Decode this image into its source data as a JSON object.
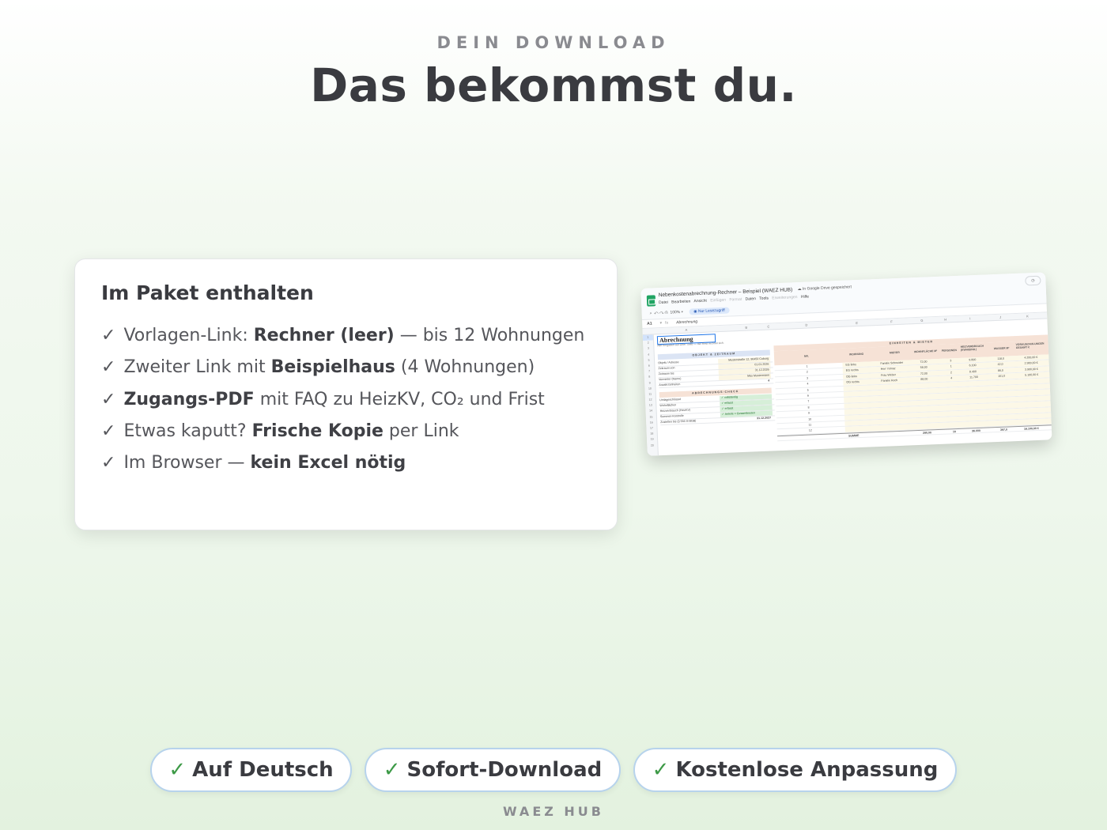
{
  "header": {
    "eyebrow": "DEIN DOWNLOAD",
    "title": "Das bekommst du."
  },
  "card": {
    "title": "Im Paket enthalten",
    "check_glyph": "✓",
    "items": [
      {
        "pre": "Vorlagen-Link: ",
        "bold": "Rechner (leer)",
        "post": " — bis 12 Wohnungen"
      },
      {
        "pre": "Zweiter Link mit ",
        "bold": "Beispielhaus",
        "post": " (4 Wohnungen)"
      },
      {
        "pre": "",
        "bold": "Zugangs-PDF",
        "post": " mit FAQ zu HeizKV, CO₂ und Frist"
      },
      {
        "pre": "Etwas kaputt? ",
        "bold": "Frische Kopie",
        "post": " per Link"
      },
      {
        "pre": "Im Browser — ",
        "bold": "kein Excel nötig",
        "post": ""
      }
    ]
  },
  "preview": {
    "doc_title": "Nebenkostenabrechnung-Rechner – Beispiel (WAEZ HUB)",
    "saved_status": "In Google Drive gespeichert",
    "menu": [
      "Datei",
      "Bearbeiten",
      "Ansicht",
      "Einfügen",
      "Format",
      "Daten",
      "Tools",
      "Erweiterungen",
      "Hilfe"
    ],
    "zoom": "100%",
    "readonly_badge": "Nur Lesezugriff",
    "cell_ref": "A1",
    "formula": "Abrechnung",
    "sheet_title": "Abrechnung",
    "sheet_subtitle": "Alle Eingaben auf einer Seite — der Rest rechnet sich.",
    "section_object": "OBJEKT & ZEITRAUM",
    "object_rows": [
      {
        "label": "Objekt / Adresse",
        "value": "Musterstraße 12, 96450 Coburg"
      },
      {
        "label": "Zeitraum von",
        "value": "01.01.2026"
      },
      {
        "label": "Zeitraum bis",
        "value": "31.12.2026"
      },
      {
        "label": "Vermieter (Name)",
        "value": "Max Mustermann"
      },
      {
        "label": "Anzahl Einheiten",
        "value": "4"
      }
    ],
    "section_check": "ABRECHNUNGS-CHECK",
    "check_rows": [
      {
        "label": "Umlageschlüssel",
        "value": "✓ vollständig"
      },
      {
        "label": "Wohnflächen",
        "value": "✓ erfasst"
      },
      {
        "label": "Heizverbrauch (HeizKV)",
        "value": "✓ erfasst"
      },
      {
        "label": "Summen-Kontrolle",
        "value": "✓ Anteile = Gesamtkosten"
      },
      {
        "label": "Zustellen bis (§ 556 III BGB)",
        "value": "31.12.2027"
      }
    ],
    "section_units": "EINHEITEN & MIETER",
    "unit_headers": [
      "NR.",
      "WOHNUNG",
      "MIETER",
      "WOHNFLÄCHE M²",
      "PERSONEN",
      "HEIZVERBRAUCH (KWH/EINH.)",
      "WASSER M³",
      "VORAUSZAHLUNGEN GESAMT €"
    ],
    "units": [
      {
        "nr": "1",
        "wohnung": "EG links",
        "mieter": "Familie Schneider",
        "flaeche": "72,00",
        "personen": "3",
        "heiz": "9.800",
        "wasser": "118,0",
        "voraus": "4.200,00 €"
      },
      {
        "nr": "2",
        "wohnung": "EG rechts",
        "mieter": "Herr Yılmaz",
        "flaeche": "58,00",
        "personen": "1",
        "heiz": "6.100",
        "wasser": "42,0",
        "voraus": "2.900,00 €"
      },
      {
        "nr": "3",
        "wohnung": "OG links",
        "mieter": "Frau Weber",
        "flaeche": "72,00",
        "personen": "2",
        "heiz": "8.400",
        "wasser": "86,0",
        "voraus": "3.900,00 €"
      },
      {
        "nr": "4",
        "wohnung": "OG rechts",
        "mieter": "Familie Koch",
        "flaeche": "88,00",
        "personen": "4",
        "heiz": "11.700",
        "wasser": "151,0",
        "voraus": "5.100,00 €"
      }
    ],
    "empty_rows": [
      "5",
      "6",
      "7",
      "8",
      "9",
      "10",
      "11",
      "12"
    ],
    "sum_row": {
      "label": "SUMME",
      "flaeche": "290,00",
      "personen": "10",
      "heiz": "36.000",
      "wasser": "397,0",
      "voraus": "16.100,00 €"
    }
  },
  "badges": [
    {
      "label": "Auf Deutsch"
    },
    {
      "label": "Sofort-Download"
    },
    {
      "label": "Kostenlose Anpassung"
    }
  ],
  "badge_check": "✓",
  "footer": "WAEZ HUB",
  "colors": {
    "text": "#3a3b40",
    "muted": "#8a8b90",
    "check_green": "#3d9a47",
    "pill_border": "#b7d3ec"
  }
}
